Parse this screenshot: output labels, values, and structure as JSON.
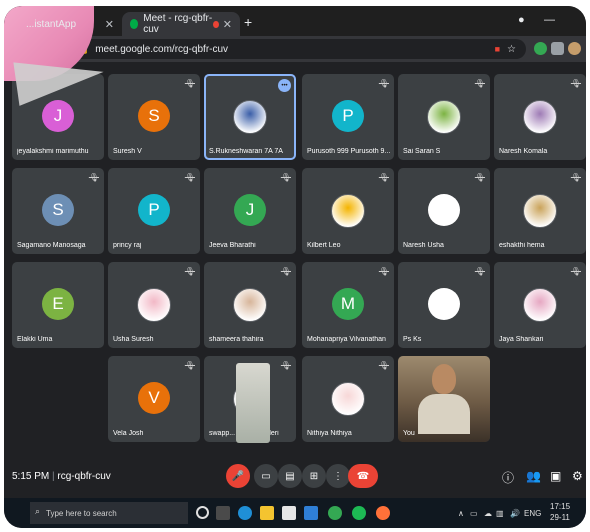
{
  "browser": {
    "tabs": [
      {
        "title": "...istantApp",
        "active": false
      },
      {
        "title": "Meet - rcg-qbfr-cuv",
        "active": true
      }
    ],
    "url": "meet.google.com/rcg-qbfr-cuv"
  },
  "participants": [
    {
      "name": "jeyalakshmi marimuthu",
      "initial": "J",
      "color": "#d95fd6",
      "muted": false
    },
    {
      "name": "Suresh V",
      "initial": "S",
      "color": "#e8710a",
      "muted": true
    },
    {
      "name": "S.Rukneshwaran 7A 7A",
      "initial": "",
      "color": "#3a5ea8",
      "muted": false,
      "highlighted": true,
      "image": true
    },
    {
      "name": "Purusoth 999 Purusoth 9...",
      "initial": "P",
      "color": "#12b5cb",
      "muted": true
    },
    {
      "name": "Sai Saran S",
      "initial": "",
      "color": "#7cb342",
      "muted": true,
      "image": true
    },
    {
      "name": "Naresh Komala",
      "initial": "",
      "color": "#9e7bb5",
      "muted": true,
      "image": true
    },
    {
      "name": "Sagamano Manosaga",
      "initial": "S",
      "color": "#6d8fb5",
      "muted": true
    },
    {
      "name": "princy raj",
      "initial": "P",
      "color": "#12b5cb",
      "muted": true
    },
    {
      "name": "Jeeva Bharathi",
      "initial": "J",
      "color": "#34a853",
      "muted": true
    },
    {
      "name": "Kilbert Leo",
      "initial": "",
      "color": "#f4b400",
      "muted": true,
      "image": true
    },
    {
      "name": "Naresh Usha",
      "initial": "",
      "color": "#ffffff",
      "muted": true
    },
    {
      "name": "eshakthi hema",
      "initial": "",
      "color": "#caa35a",
      "muted": true,
      "image": true
    },
    {
      "name": "Elakki Uma",
      "initial": "E",
      "color": "#7cb342",
      "muted": false
    },
    {
      "name": "Usha Suresh",
      "initial": "",
      "color": "#f2b8c6",
      "muted": true,
      "image": true
    },
    {
      "name": "shameera thahira",
      "initial": "",
      "color": "#d7b59a",
      "muted": true,
      "image": true
    },
    {
      "name": "Mohanapriya Vilvanathan",
      "initial": "M",
      "color": "#34a853",
      "muted": true
    },
    {
      "name": "Ps Ks",
      "initial": "",
      "color": "#ffffff",
      "muted": true
    },
    {
      "name": "Jaya Shankari",
      "initial": "",
      "color": "#e6a7c2",
      "muted": true,
      "image": true
    },
    {
      "name": "Vela Josh",
      "initial": "V",
      "color": "#e8710a",
      "muted": true
    },
    {
      "name": "swapp... ...teri Sunderi",
      "initial": "",
      "color": "#c6c9c4",
      "muted": true,
      "image": true
    },
    {
      "name": "Nithiya Nithiya",
      "initial": "",
      "color": "#f7d7d7",
      "muted": true,
      "image": true
    },
    {
      "name": "You",
      "initial": "",
      "color": "#9d8a6e",
      "muted": false,
      "video": true
    }
  ],
  "meeting": {
    "time": "5:15 PM",
    "separator": "|",
    "code": "rcg-qbfr-cuv"
  },
  "taskbar": {
    "search_placeholder": "Type here to search",
    "lang": "ENG",
    "clock_time": "17:15",
    "clock_date": "29-11"
  },
  "colors": {
    "accent": "#8ab4f8",
    "end_call": "#ea4335",
    "tile_bg": "#3c4043"
  }
}
